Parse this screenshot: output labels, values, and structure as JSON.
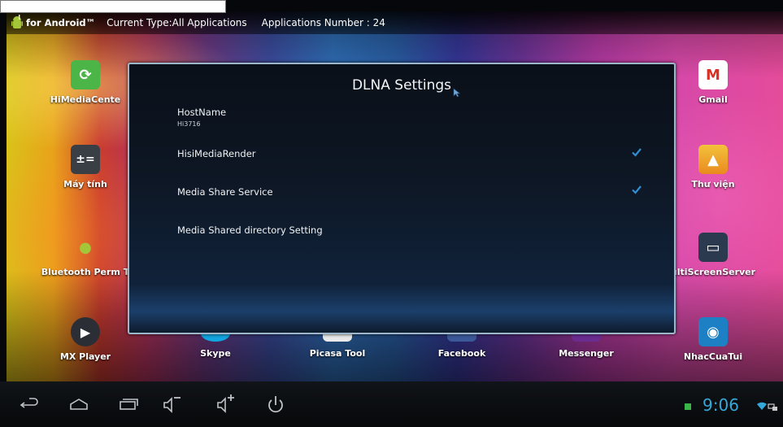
{
  "header": {
    "brand": "for Android™",
    "current_type": "Current Type:All Applications",
    "app_count": "Applications Number : 24"
  },
  "apps": {
    "himedia": "HiMediaCente",
    "gmail": "Gmail",
    "calculator": "Máy tính",
    "gallery": "Thư viện",
    "bluetooth": "Bluetooth Perm T",
    "multiscreen": "ultiScreenServer",
    "mxplayer": "MX Player",
    "skype": "Skype",
    "picasa": "Picasa Tool",
    "facebook": "Facebook",
    "messenger": "Messenger",
    "nhaccuatui": "NhacCuaTui"
  },
  "dialog": {
    "title": "DLNA Settings",
    "hostname_label": "HostName",
    "hostname_value": "Hi3716",
    "render_label": "HisiMediaRender",
    "share_label": "Media Share Service",
    "dir_label": "Media Shared directory Setting"
  },
  "status": {
    "time": "9:06"
  },
  "colors": {
    "accent": "#35a7d8",
    "check": "#2f8fd0"
  }
}
